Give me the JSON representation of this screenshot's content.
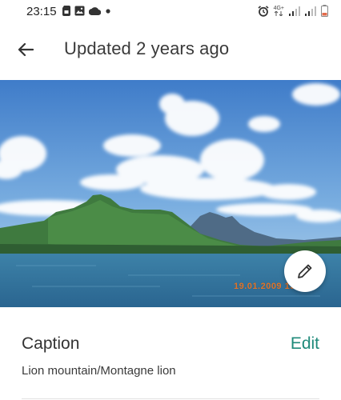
{
  "status_bar": {
    "time": "23:15",
    "network_label": "4G+",
    "left_icons": [
      "sim-card-icon",
      "gallery-icon",
      "cloud-icon",
      "dot-icon"
    ],
    "right_icons": [
      "alarm-icon",
      "network-4g-icon",
      "signal-icon",
      "signal-icon",
      "battery-icon"
    ]
  },
  "header": {
    "title": "Updated 2 years ago",
    "back_icon": "arrow-back-icon"
  },
  "photo": {
    "date_stamp": "19.01.2009 15",
    "edit_icon": "pencil-icon"
  },
  "caption": {
    "heading": "Caption",
    "edit_label": "Edit",
    "text": "Lion mountain/Montagne lion"
  },
  "colors": {
    "accent": "#1f8a7a",
    "date_stamp": "#e0742a"
  }
}
